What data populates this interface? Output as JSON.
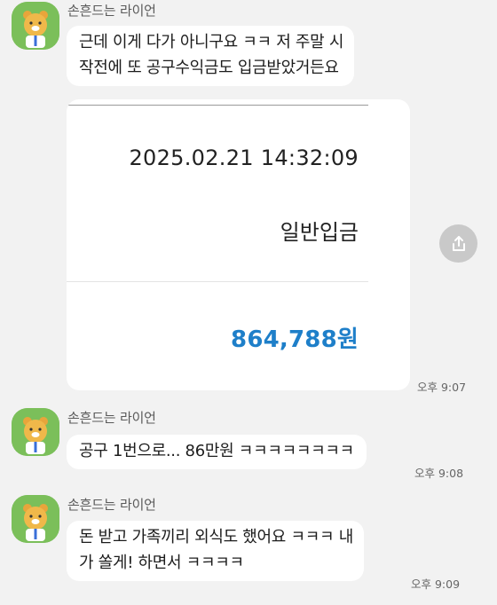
{
  "messages": [
    {
      "sender": "손흔드는 라이언",
      "lines": [
        "근데 이게 다가 아니구요 ㅋㅋ 저 주말 시",
        "작전에 또 공구수익금도 입금받았거든요"
      ]
    },
    {
      "card": {
        "datetime": "2025.02.21 14:32:09",
        "kind": "일반입금",
        "amount": "864,788원"
      },
      "time": "오후 9:07"
    },
    {
      "sender": "손흔드는 라이언",
      "lines": [
        "공구 1번으로...  86만원 ㅋㅋㅋㅋㅋㅋㅋㅋ"
      ],
      "time": "오후 9:08"
    },
    {
      "sender": "손흔드는 라이언",
      "lines": [
        "돈 받고 가족끼리 외식도 했어요 ㅋㅋㅋ 내",
        "가 쏠게! 하면서 ㅋㅋㅋㅋ"
      ],
      "time": "오후 9:09"
    }
  ],
  "icons": {
    "avatar": "ryan-character-icon",
    "share": "share-icon"
  },
  "colors": {
    "background": "#f2f2f2",
    "bubble": "#ffffff",
    "amount": "#1e7fc9",
    "avatar_bg": "#7bbf5a"
  }
}
